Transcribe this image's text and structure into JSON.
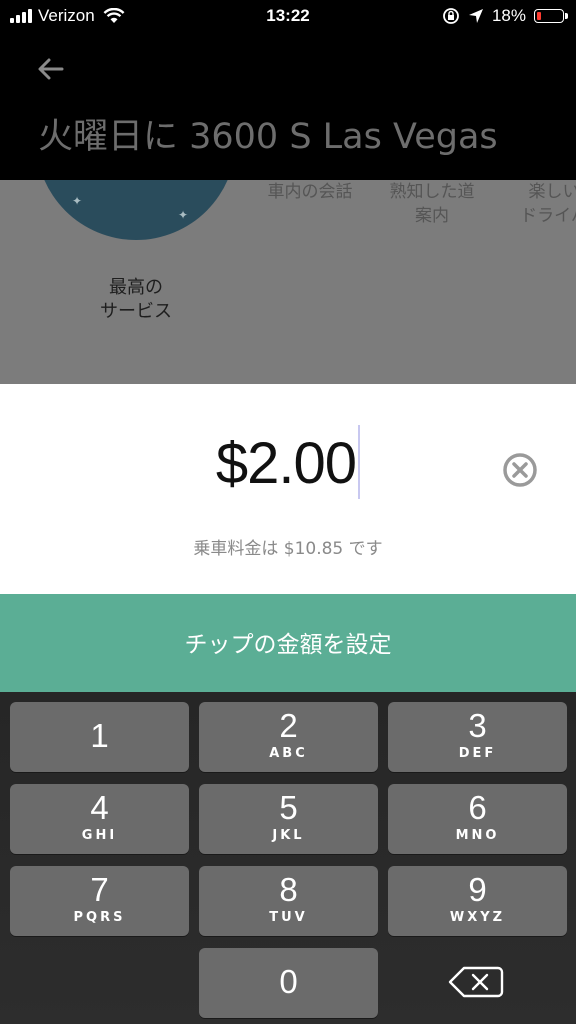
{
  "status_bar": {
    "carrier": "Verizon",
    "time": "13:22",
    "battery_percent": "18%",
    "battery_level": 0.18,
    "battery_color": "#ff3b30"
  },
  "header": {
    "title": "火曜日に 3600 S Las Vegas"
  },
  "rating": {
    "badge_label": "最高の\nサービス",
    "compliments": [
      "車内の会話",
      "熟知した道\n案内",
      "楽しい\nドライバ"
    ]
  },
  "tip": {
    "amount": "$2.00",
    "fare_note": "乗車料金は $10.85 です",
    "set_button_label": "チップの金額を設定",
    "accent_color": "#5bae95"
  },
  "keypad": {
    "keys": [
      {
        "digit": "1",
        "letters": ""
      },
      {
        "digit": "2",
        "letters": "ABC"
      },
      {
        "digit": "3",
        "letters": "DEF"
      },
      {
        "digit": "4",
        "letters": "GHI"
      },
      {
        "digit": "5",
        "letters": "JKL"
      },
      {
        "digit": "6",
        "letters": "MNO"
      },
      {
        "digit": "7",
        "letters": "PQRS"
      },
      {
        "digit": "8",
        "letters": "TUV"
      },
      {
        "digit": "9",
        "letters": "WXYZ"
      },
      {
        "digit": "0",
        "letters": ""
      }
    ],
    "delete_icon": "backspace-icon"
  }
}
